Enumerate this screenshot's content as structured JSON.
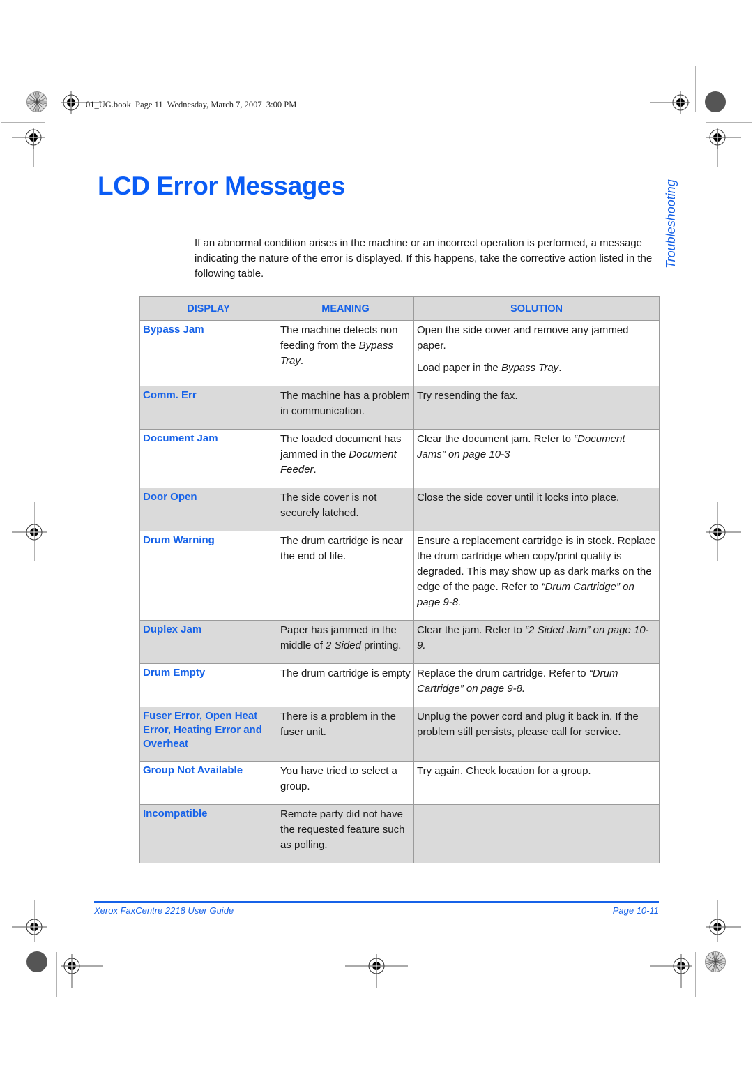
{
  "book_header": "01_UG.book  Page 11  Wednesday, March 7, 2007  3:00 PM",
  "page_title": "LCD Error Messages",
  "side_tab": "Troubleshooting",
  "intro": "If an abnormal condition arises in the machine or an incorrect operation is performed, a message indicating the nature of the error is displayed. If this happens, take the corrective action listed in the following table.",
  "table": {
    "headers": [
      "DISPLAY",
      "MEANING",
      "SOLUTION"
    ],
    "rows": [
      {
        "shade": "white",
        "display": "Bypass Jam",
        "meaning": [
          {
            "t": "The machine detects non feeding from the "
          },
          {
            "t": "Bypass Tray",
            "i": true
          },
          {
            "t": "."
          }
        ],
        "solution": [
          [
            {
              "t": "Open the side cover and remove any jammed paper."
            }
          ],
          [
            {
              "t": "Load paper in the "
            },
            {
              "t": "Bypass Tray",
              "i": true
            },
            {
              "t": "."
            }
          ]
        ]
      },
      {
        "shade": "gray",
        "display": "Comm. Err",
        "meaning": [
          {
            "t": "The machine has a problem in communication."
          }
        ],
        "solution": [
          [
            {
              "t": "Try resending the fax."
            }
          ]
        ]
      },
      {
        "shade": "white",
        "display": "Document Jam",
        "meaning": [
          {
            "t": "The loaded document has jammed in the "
          },
          {
            "t": "Document Feeder",
            "i": true
          },
          {
            "t": "."
          }
        ],
        "solution": [
          [
            {
              "t": "Clear the document jam. Refer to "
            },
            {
              "t": "“Document Jams” on page 10-3",
              "i": true
            }
          ]
        ]
      },
      {
        "shade": "gray",
        "display": "Door Open",
        "meaning": [
          {
            "t": "The side cover is not securely latched."
          }
        ],
        "solution": [
          [
            {
              "t": "Close the side cover until it locks into place."
            }
          ]
        ]
      },
      {
        "shade": "white",
        "display": "Drum Warning",
        "meaning": [
          {
            "t": "The drum cartridge is near the end of life."
          }
        ],
        "solution": [
          [
            {
              "t": "Ensure a replacement cartridge is in stock. Replace the drum cartridge when copy/print quality is degraded. This may show up as dark marks on the edge of the page. Refer to "
            },
            {
              "t": "“Drum Cartridge” on page 9-8.",
              "i": true
            }
          ]
        ]
      },
      {
        "shade": "gray",
        "display": "Duplex Jam",
        "meaning": [
          {
            "t": "Paper has jammed in the middle of "
          },
          {
            "t": "2 Sided",
            "i": true
          },
          {
            "t": " printing."
          }
        ],
        "solution": [
          [
            {
              "t": "Clear the jam. Refer to "
            },
            {
              "t": "“2 Sided Jam” on page 10-9.",
              "i": true
            }
          ]
        ]
      },
      {
        "shade": "white",
        "display": "Drum Empty",
        "meaning": [
          {
            "t": "The drum cartridge is empty"
          }
        ],
        "solution": [
          [
            {
              "t": "Replace the drum cartridge. Refer to "
            },
            {
              "t": "“Drum Cartridge” on page 9-8.",
              "i": true
            }
          ]
        ]
      },
      {
        "shade": "gray",
        "display": "Fuser Error, Open Heat Error, Heating Error and Overheat",
        "meaning": [
          {
            "t": "There is a problem in the fuser unit."
          }
        ],
        "solution": [
          [
            {
              "t": "Unplug the power cord and plug it back in. If the problem still persists, please call for service."
            }
          ]
        ]
      },
      {
        "shade": "white",
        "display": "Group Not Available",
        "meaning": [
          {
            "t": "You have tried to select a group."
          }
        ],
        "solution": [
          [
            {
              "t": "Try again. Check location for a group."
            }
          ]
        ]
      },
      {
        "shade": "gray",
        "display": "Incompatible",
        "meaning": [
          {
            "t": "Remote party did not have the requested feature such as polling."
          }
        ],
        "solution": []
      }
    ]
  },
  "footer": {
    "left": "Xerox FaxCentre 2218 User Guide",
    "right": "Page 10-11"
  },
  "colors": {
    "accent_blue": "#1662e8",
    "title_blue": "#0a5cf5",
    "row_gray": "#dadada"
  },
  "icons": {
    "registration_mark": "registration-crosshair-icon",
    "color_bar": "starburst-calibration-icon"
  }
}
